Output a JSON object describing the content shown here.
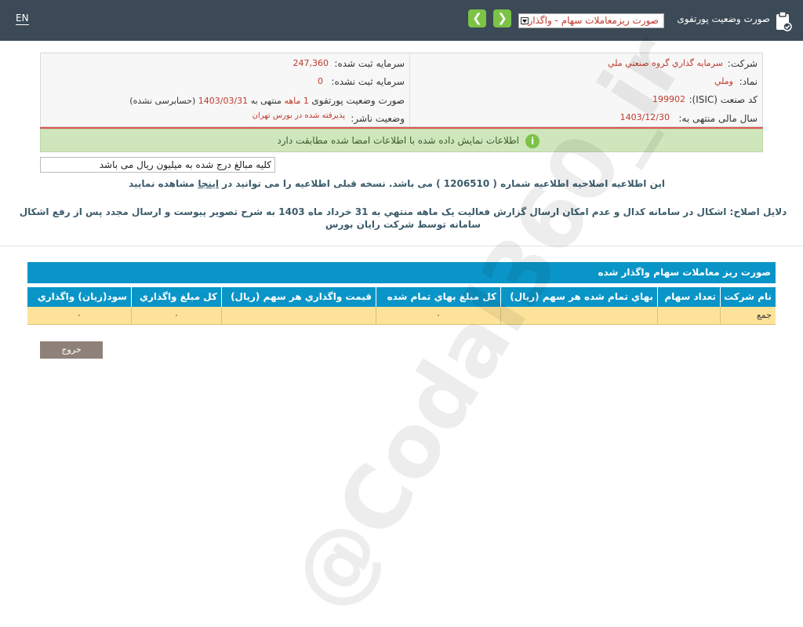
{
  "header": {
    "lang": "EN",
    "report_label": "صورت وضعیت پورتفوی",
    "report_select_value": "صورت ریزمعاملات سهام - واگذاری",
    "prev_icon": "chevron-left-icon",
    "next_icon": "chevron-right-icon",
    "portfolio_icon": "clipboard-check-icon"
  },
  "info": {
    "company_label": "شرکت:",
    "company_value": "سرمايه گذاري گروه صنعتي ملي",
    "symbol_label": "نماد:",
    "symbol_value": "وملي",
    "isic_label": "کد صنعت (ISIC):",
    "isic_value": "199902",
    "fiscal_label": "سال مالی منتهی به:",
    "fiscal_value": "1403/12/30",
    "reg_capital_label": "سرمایه ثبت شده:",
    "reg_capital_value": "247,360",
    "unreg_capital_label": "سرمایه ثبت نشده:",
    "unreg_capital_value": "0",
    "portfolio_label": "صورت وضعیت پورتفوی",
    "portfolio_period": "1 ماهه",
    "portfolio_ending": "منتهی به",
    "portfolio_date": "1403/03/31",
    "portfolio_audit": "(حسابرسی نشده)",
    "publisher_label": "وضعیت ناشر:",
    "publisher_value": "پذیرفته شده در بورس تهران"
  },
  "banner": {
    "text": "اطلاعات نمایش داده شده با اطلاعات امضا شده مطابقت دارد",
    "icon": "info-icon"
  },
  "units_note": "کلیه مبالغ درج شده به میلیون ریال می باشد",
  "notice": {
    "before": "این اطلاعیه اصلاحیه اطلاعیه شماره ( 1206510 ) می باشد. نسخه قبلی اطلاعیه را می توانید در",
    "link": "اینجا",
    "after": "مشاهده نمایید"
  },
  "reasons": "دلایل اصلاح: اشکال در سامانه کدال و عدم امکان ارسال گزارش فعالیت یک ماهه منتهي به 31 خرداد ماه 1403 به شرح تصویر پیوست و ارسال مجدد پس از رفع اشکال سامانه توسط شرکت رایان بورس",
  "table": {
    "title": "صورت ریز معاملات سهام واگذار شده",
    "headers": [
      "نام شرکت",
      "تعداد سهام",
      "بهاي تمام شده هر سهم (ريال)",
      "كل مبلغ بهاي تمام شده",
      "قيمت واگذاري هر سهم (ريال)",
      "كل مبلغ واگذاري",
      "سود(زيان) واگذاري"
    ],
    "total_row": [
      "جمع",
      "",
      "",
      "۰",
      "",
      "۰",
      "۰"
    ]
  },
  "exit_label": "خروج",
  "watermark": "@Codal360_ir",
  "colors": {
    "topbar": "#3b4a56",
    "accent_green": "#7cc246",
    "table_blue": "#0a95c8",
    "total_row": "#fde39a"
  }
}
